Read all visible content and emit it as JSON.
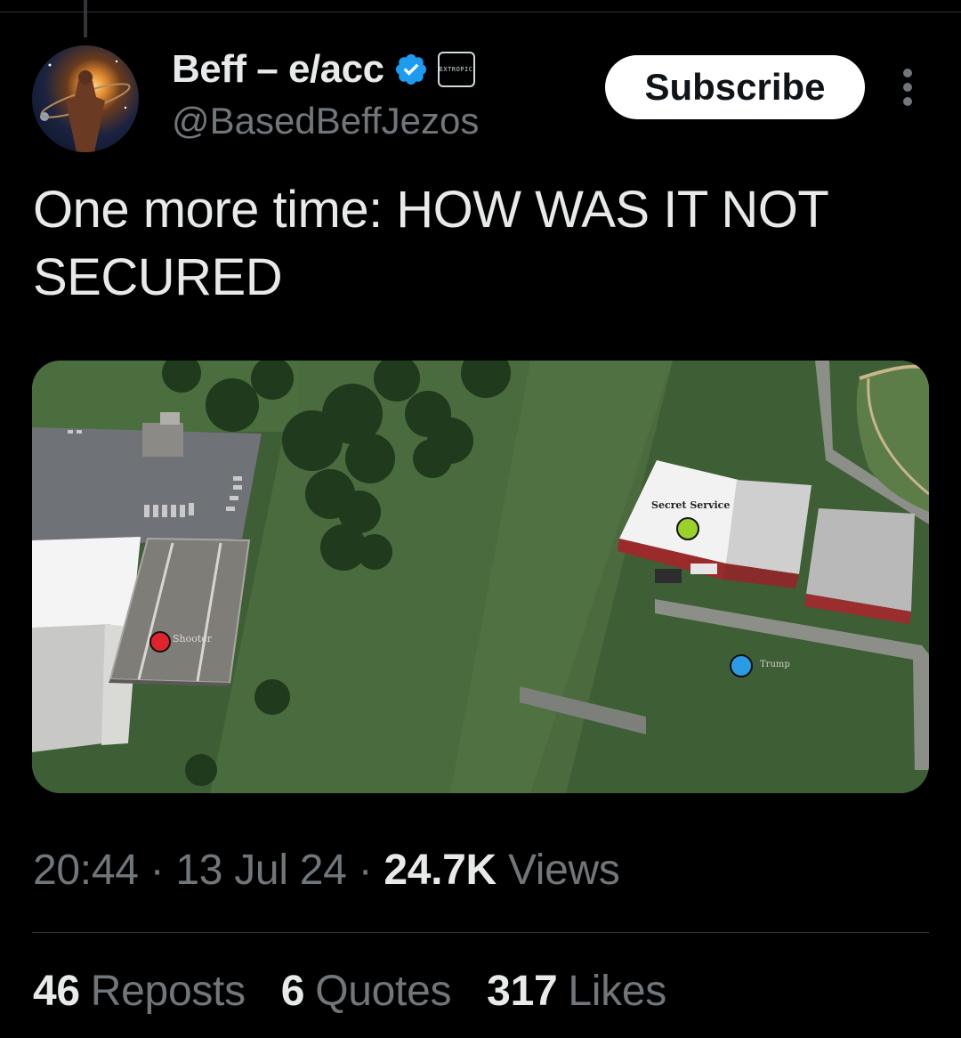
{
  "post": {
    "author": {
      "display_name": "Beff – e/acc",
      "handle": "@BasedBeffJezos",
      "verified_icon": "verified-badge-icon",
      "affiliate_badge": "EXTROPIC"
    },
    "subscribe_label": "Subscribe",
    "text": "One more time: HOW WAS IT NOT SECURED",
    "media": {
      "labels": {
        "shooter": "Shooter",
        "secret_service": "Secret Service",
        "trump": "Trump"
      },
      "marker_colors": {
        "shooter": "#e0242b",
        "secret_service": "#9bd12a",
        "trump": "#2b9be6"
      }
    },
    "time": "20:44",
    "date": "13 Jul 24",
    "views_count": "24.7K",
    "views_label": "Views",
    "reposts_count": "46",
    "reposts_label": "Reposts",
    "quotes_count": "6",
    "quotes_label": "Quotes",
    "likes_count": "317",
    "likes_label": "Likes"
  },
  "colors": {
    "background": "#000000",
    "text_primary": "#e7e9ea",
    "text_secondary": "#71767b",
    "verified_blue": "#1d9bf0",
    "divider": "#2f3336"
  }
}
